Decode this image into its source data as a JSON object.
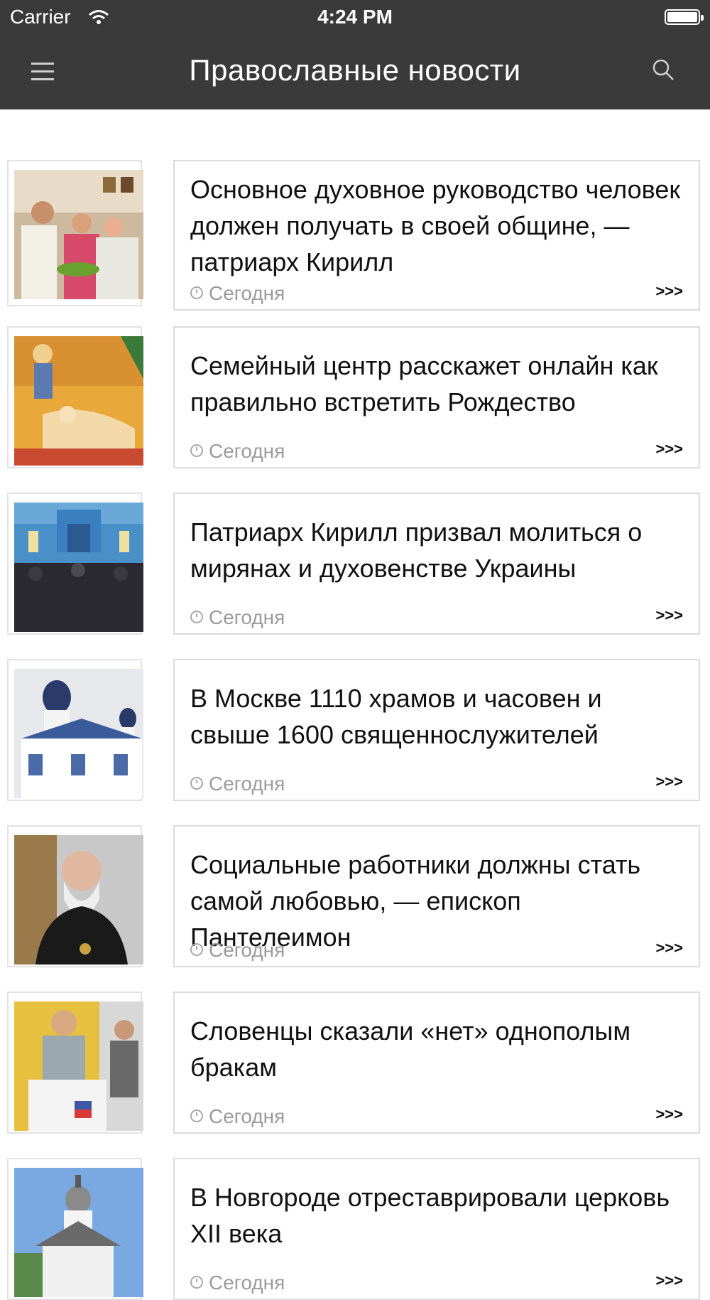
{
  "status_bar": {
    "carrier": "Carrier",
    "time": "4:24 PM"
  },
  "header": {
    "title": "Православные новости"
  },
  "icons": {
    "menu": "hamburger-menu-icon",
    "search": "search-icon",
    "clock": "clock-icon"
  },
  "colors": {
    "bar_bg": "#3a3a3a",
    "card_border": "#dcdcdc",
    "meta_text": "#9b9b9b"
  },
  "news": [
    {
      "headline": "Основное духовное руководство человек должен получать в своей общине, — патриарх Кирилл",
      "date": "Сегодня",
      "more": ">>>"
    },
    {
      "headline": "Семейный центр расскажет онлайн как правильно встретить Рождество",
      "date": "Сегодня",
      "more": ">>>"
    },
    {
      "headline": "Патриарх Кирилл призвал молиться о мирянах и духовенстве Украины",
      "date": "Сегодня",
      "more": ">>>"
    },
    {
      "headline": "В Москве 1110 храмов и часовен и свыше 1600 священнослужителей",
      "date": "Сегодня",
      "more": ">>>"
    },
    {
      "headline": "Социальные работники должны стать самой любовью, — епископ Пантелеимон",
      "date": "Сегодня",
      "more": ">>>"
    },
    {
      "headline": "Словенцы сказали «нет» однополым бракам",
      "date": "Сегодня",
      "more": ">>>"
    },
    {
      "headline": "В Новгороде отреставрировали церковь XII века",
      "date": "Сегодня",
      "more": ">>>"
    }
  ]
}
